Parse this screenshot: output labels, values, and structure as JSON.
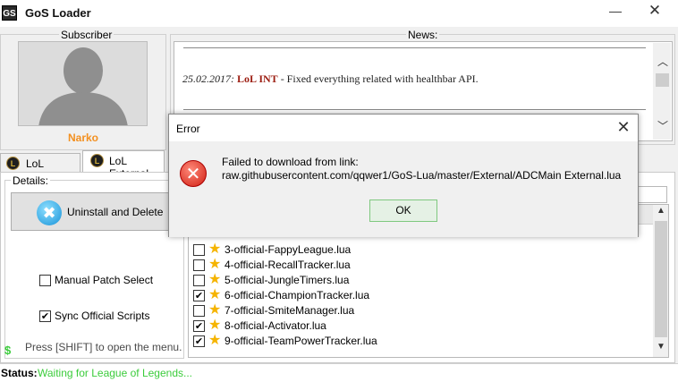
{
  "window": {
    "title": "GoS Loader",
    "app_icon": "GS",
    "minimize": "—",
    "close": "✕"
  },
  "subscriber": {
    "label": "Subscriber",
    "username": "Narko"
  },
  "news": {
    "label": "News:",
    "date": "25.02.2017:",
    "tag": "LoL INT",
    "text": " - Fixed everything related with healthbar API."
  },
  "tabs": [
    {
      "label": "LoL Internal",
      "active": false
    },
    {
      "label": "LoL External",
      "active": true
    }
  ],
  "details": {
    "label": "Details:",
    "uninstall_label": "Uninstall and Delete",
    "manual_patch": {
      "label": "Manual Patch Select",
      "checked": false
    },
    "sync_scripts": {
      "label": "Sync Official Scripts",
      "checked": true
    },
    "shift_hint": "Press [SHIFT] to open the menu.",
    "dollar": "$"
  },
  "scripts": [
    {
      "name": "3-official-FappyLeague.lua",
      "checked": false,
      "check_mark": ""
    },
    {
      "name": "4-official-RecallTracker.lua",
      "checked": false,
      "check_mark": ""
    },
    {
      "name": "5-official-JungleTimers.lua",
      "checked": false,
      "check_mark": ""
    },
    {
      "name": "6-official-ChampionTracker.lua",
      "checked": true,
      "check_mark": "✔"
    },
    {
      "name": "7-official-SmiteManager.lua",
      "checked": false,
      "check_mark": ""
    },
    {
      "name": "8-official-Activator.lua",
      "checked": true,
      "check_mark": "✔"
    },
    {
      "name": "9-official-TeamPowerTracker.lua",
      "checked": true,
      "check_mark": "✔"
    }
  ],
  "status": {
    "label": "Status:",
    "value": "Waiting for League of Legends..."
  },
  "error_dialog": {
    "title": "Error",
    "close": "✕",
    "line1": "Failed to download from link:",
    "line2": "raw.githubusercontent.com/qqwer1/GoS-Lua/master/External/ADCMain External.lua",
    "ok_label": "OK",
    "icon_glyph": "✕"
  },
  "icons": {
    "uninstall": "✖",
    "star": "★",
    "check": "✔",
    "scroll_up": "▲",
    "scroll_down": "▼",
    "news_up": "︿",
    "news_down": "﹀"
  },
  "colors": {
    "username": "#f39020",
    "news_tag": "#9c1e12",
    "status_value": "#3bcc3b",
    "error_icon": "#d01e12",
    "star": "#f5b400"
  }
}
